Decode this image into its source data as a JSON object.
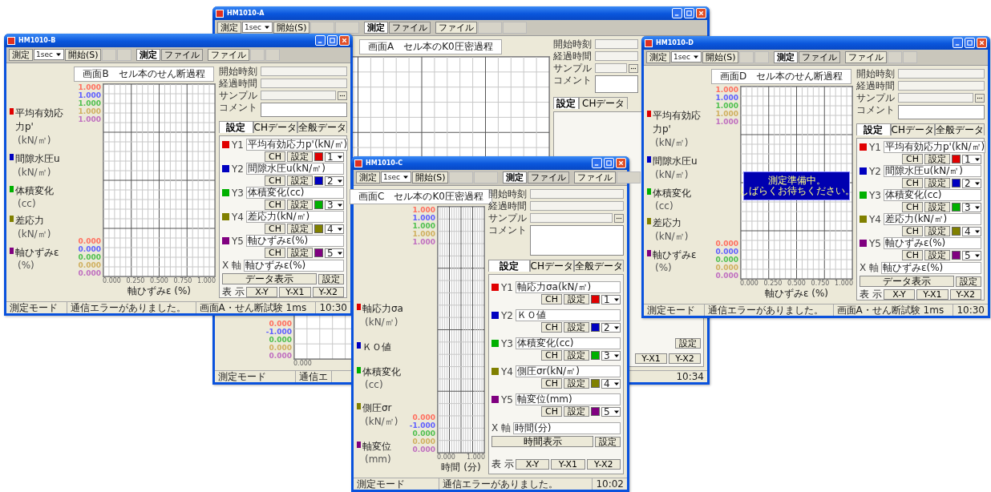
{
  "windows": [
    {
      "title": "HM1010-A",
      "toolbar": [
        [
          {
            "kind": "button",
            "label": "測定"
          },
          {
            "kind": "select",
            "label": "1sec"
          },
          {
            "kind": "button",
            "label": "開始(S)"
          },
          {
            "kind": "disabled"
          },
          {
            "kind": "disabled"
          }
        ],
        [
          {
            "kind": "toggle",
            "label": "測定",
            "selected": true
          },
          {
            "kind": "toggle",
            "label": "ファイル",
            "selected": false
          }
        ],
        [
          {
            "kind": "button",
            "label": "ファイル"
          },
          {
            "kind": "disabled"
          },
          {
            "kind": "disabled"
          }
        ]
      ],
      "chart": {
        "title": "画面A　セル本のK0圧密過程",
        "ticks_bottom": [
          {
            "text": "0.000",
            "color": "#ff7060"
          },
          {
            "text": "-1.000",
            "color": "#6060ff"
          },
          {
            "text": "0.000",
            "color": "#50c050"
          },
          {
            "text": "0.000",
            "color": "#d0b060"
          },
          {
            "text": "0.000",
            "color": "#c070c0"
          }
        ],
        "x_ticks": [
          "0.000"
        ]
      },
      "info": [
        {
          "label": "開始時刻",
          "kind": "field"
        },
        {
          "label": "経過時間",
          "kind": "field"
        },
        {
          "label": "サンプル",
          "kind": "browse"
        },
        {
          "label": "コメント",
          "kind": "comment"
        }
      ],
      "tabs": [
        {
          "label": "設定",
          "selected": true
        },
        {
          "label": "CHデータ",
          "selected": false
        }
      ],
      "x_axis": {
        "buttons": [
          "設定"
        ]
      },
      "display": {
        "buttons": [
          "Y-X1",
          "Y-X2"
        ]
      },
      "status": [
        "測定モード",
        "通信エ",
        "10:34"
      ]
    },
    {
      "title": "HM1010-B",
      "toolbar": [
        [
          {
            "kind": "button",
            "label": "測定"
          },
          {
            "kind": "select",
            "label": "1sec"
          },
          {
            "kind": "button",
            "label": "開始(S)"
          },
          {
            "kind": "disabled"
          },
          {
            "kind": "disabled"
          }
        ],
        [
          {
            "kind": "toggle",
            "label": "測定",
            "selected": true
          },
          {
            "kind": "toggle",
            "label": "ファイル",
            "selected": false
          }
        ],
        [
          {
            "kind": "button",
            "label": "ファイル"
          },
          {
            "kind": "disabled"
          },
          {
            "kind": "disabled"
          }
        ]
      ],
      "chart": {
        "title": "画面B　セル本のせん断過程",
        "ticks_top": [
          {
            "text": "1.000",
            "color": "#ff7060"
          },
          {
            "text": "1.000",
            "color": "#6060ff"
          },
          {
            "text": "1.000",
            "color": "#50c050"
          },
          {
            "text": "1.000",
            "color": "#d0b060"
          },
          {
            "text": "1.000",
            "color": "#c070c0"
          }
        ],
        "ticks_bottom": [
          {
            "text": "0.000",
            "color": "#ff7060"
          },
          {
            "text": "0.000",
            "color": "#6060ff"
          },
          {
            "text": "0.000",
            "color": "#50c050"
          },
          {
            "text": "0.000",
            "color": "#d0b060"
          },
          {
            "text": "0.000",
            "color": "#c070c0"
          }
        ],
        "x_ticks": [
          "0.000",
          "0.250",
          "0.500",
          "0.750",
          "1.000"
        ],
        "x_label": "軸ひずみε (%)"
      },
      "legend": [
        {
          "label": "平均有効応力p'",
          "unit": "(kN/㎡)",
          "color": "#e00000"
        },
        {
          "label": "間隙水圧u",
          "unit": "(kN/㎡)",
          "color": "#0000c0"
        },
        {
          "label": "体積変化",
          "unit": "(cc)",
          "color": "#00b000"
        },
        {
          "label": "差応力",
          "unit": "(kN/㎡)",
          "color": "#808000"
        },
        {
          "label": "軸ひずみε",
          "unit": "(%)",
          "color": "#800080"
        }
      ],
      "info": [
        {
          "label": "開始時刻",
          "kind": "field"
        },
        {
          "label": "経過時間",
          "kind": "field"
        },
        {
          "label": "サンプル",
          "kind": "browse"
        },
        {
          "label": "コメント",
          "kind": "comment"
        }
      ],
      "tabs": [
        {
          "label": "設定",
          "selected": true
        },
        {
          "label": "CHデータ",
          "selected": false
        },
        {
          "label": "全般データ",
          "selected": false
        }
      ],
      "channels": [
        {
          "axis": "Y1",
          "name": "平均有効応力p'(kN/㎡)",
          "color": "#e00000",
          "buttons": [
            "CH",
            "設定"
          ],
          "number": "1"
        },
        {
          "axis": "Y2",
          "name": "間隙水圧u(kN/㎡)",
          "color": "#0000c0",
          "buttons": [
            "CH",
            "設定"
          ],
          "number": "2"
        },
        {
          "axis": "Y3",
          "name": "体積変化(cc)",
          "color": "#00b000",
          "buttons": [
            "CH",
            "設定"
          ],
          "number": "3"
        },
        {
          "axis": "Y4",
          "name": "差応力(kN/㎡)",
          "color": "#808000",
          "buttons": [
            "CH",
            "設定"
          ],
          "number": "4"
        },
        {
          "axis": "Y5",
          "name": "軸ひずみε(%)",
          "color": "#800080",
          "buttons": [
            "CH",
            "設定"
          ],
          "number": "5"
        }
      ],
      "x_axis": {
        "axis": "X 軸",
        "name": "軸ひずみε(%)",
        "buttons": [
          "データ表示",
          "設定"
        ]
      },
      "display": {
        "label": "表 示",
        "buttons": [
          "X-Y",
          "Y-X1",
          "Y-X2"
        ]
      },
      "status": [
        "測定モード",
        "通信エラーがありました。",
        "画面A・せん断試験 1ms",
        "10:30"
      ]
    },
    {
      "title": "HM1010-D",
      "toolbar": [
        [
          {
            "kind": "button",
            "label": "測定"
          },
          {
            "kind": "select",
            "label": "1sec"
          },
          {
            "kind": "button",
            "label": "開始(S)"
          },
          {
            "kind": "disabled"
          },
          {
            "kind": "disabled"
          }
        ],
        [
          {
            "kind": "toggle",
            "label": "測定",
            "selected": true
          },
          {
            "kind": "toggle",
            "label": "ファイル",
            "selected": false
          }
        ],
        [
          {
            "kind": "button",
            "label": "ファイル"
          },
          {
            "kind": "disabled"
          },
          {
            "kind": "disabled"
          }
        ]
      ],
      "chart": {
        "title": "画面D　セル本のせん断過程",
        "ticks_top": [
          {
            "text": "1.000",
            "color": "#ff7060"
          },
          {
            "text": "1.000",
            "color": "#6060ff"
          },
          {
            "text": "1.000",
            "color": "#50c050"
          },
          {
            "text": "1.000",
            "color": "#d0b060"
          },
          {
            "text": "1.000",
            "color": "#c070c0"
          }
        ],
        "ticks_bottom": [
          {
            "text": "0.000",
            "color": "#ff7060"
          },
          {
            "text": "0.000",
            "color": "#6060ff"
          },
          {
            "text": "0.000",
            "color": "#50c050"
          },
          {
            "text": "0.000",
            "color": "#d0b060"
          },
          {
            "text": "0.000",
            "color": "#c070c0"
          }
        ],
        "x_ticks": [
          "0.000",
          "0.250",
          "0.500",
          "0.750",
          "1.000"
        ],
        "x_label": "軸ひずみε (%)",
        "banner": [
          "測定準備中。",
          "しばらくお待ちください。"
        ]
      },
      "legend": [
        {
          "label": "平均有効応力p'",
          "unit": "(kN/㎡)",
          "color": "#e00000"
        },
        {
          "label": "間隙水圧u",
          "unit": "(kN/㎡)",
          "color": "#0000c0"
        },
        {
          "label": "体積変化",
          "unit": "(cc)",
          "color": "#00b000"
        },
        {
          "label": "差応力",
          "unit": "(kN/㎡)",
          "color": "#808000"
        },
        {
          "label": "軸ひずみε",
          "unit": "(%)",
          "color": "#800080"
        }
      ],
      "info": [
        {
          "label": "開始時刻",
          "kind": "field"
        },
        {
          "label": "経過時間",
          "kind": "field"
        },
        {
          "label": "サンプル",
          "kind": "browse"
        },
        {
          "label": "コメント",
          "kind": "comment"
        }
      ],
      "tabs": [
        {
          "label": "設定",
          "selected": true
        },
        {
          "label": "CHデータ",
          "selected": false
        },
        {
          "label": "全般データ",
          "selected": false
        }
      ],
      "channels": [
        {
          "axis": "Y1",
          "name": "平均有効応力p'(kN/㎡)",
          "color": "#e00000",
          "buttons": [
            "CH",
            "設定"
          ],
          "number": "1"
        },
        {
          "axis": "Y2",
          "name": "間隙水圧u(kN/㎡)",
          "color": "#0000c0",
          "buttons": [
            "CH",
            "設定"
          ],
          "number": "2"
        },
        {
          "axis": "Y3",
          "name": "体積変化(cc)",
          "color": "#00b000",
          "buttons": [
            "CH",
            "設定"
          ],
          "number": "3"
        },
        {
          "axis": "Y4",
          "name": "差応力(kN/㎡)",
          "color": "#808000",
          "buttons": [
            "CH",
            "設定"
          ],
          "number": "4"
        },
        {
          "axis": "Y5",
          "name": "軸ひずみε(%)",
          "color": "#800080",
          "buttons": [
            "CH",
            "設定"
          ],
          "number": "5"
        }
      ],
      "x_axis": {
        "axis": "X 軸",
        "name": "軸ひずみε(%)",
        "buttons": [
          "データ表示",
          "設定"
        ]
      },
      "display": {
        "label": "表 示",
        "buttons": [
          "X-Y",
          "Y-X1",
          "Y-X2"
        ]
      },
      "status": [
        "測定モード",
        "通信エラーがありました。",
        "画面A・せん断試験 1ms",
        "10:30"
      ]
    },
    {
      "title": "HM1010-C",
      "toolbar": [
        [
          {
            "kind": "button",
            "label": "測定"
          },
          {
            "kind": "select",
            "label": "1sec"
          },
          {
            "kind": "button",
            "label": "開始(S)"
          },
          {
            "kind": "disabled"
          },
          {
            "kind": "disabled"
          }
        ],
        [
          {
            "kind": "toggle",
            "label": "測定",
            "selected": true
          },
          {
            "kind": "toggle",
            "label": "ファイル",
            "selected": false
          }
        ],
        [
          {
            "kind": "button",
            "label": "ファイル"
          },
          {
            "kind": "disabled"
          }
        ]
      ],
      "chart": {
        "title": "画面C　セル本のK0圧密過程",
        "ticks_top": [
          {
            "text": "1.000",
            "color": "#ff7060"
          },
          {
            "text": "1.000",
            "color": "#6060ff"
          },
          {
            "text": "1.000",
            "color": "#50c050"
          },
          {
            "text": "1.000",
            "color": "#d0b060"
          },
          {
            "text": "1.000",
            "color": "#c070c0"
          }
        ],
        "ticks_bottom": [
          {
            "text": "0.000",
            "color": "#ff7060"
          },
          {
            "text": "-1.000",
            "color": "#6060ff"
          },
          {
            "text": "0.000",
            "color": "#50c050"
          },
          {
            "text": "0.000",
            "color": "#d0b060"
          },
          {
            "text": "0.000",
            "color": "#c070c0"
          }
        ],
        "x_ticks": [
          "0.000",
          "1.000"
        ],
        "x_label": "時間 (分)"
      },
      "legend": [
        {
          "label": "軸応力σa",
          "unit": "(kN/㎡)",
          "color": "#e00000"
        },
        {
          "label": "ＫＯ値",
          "color": "#0000c0"
        },
        {
          "label": "体積変化",
          "unit": "(cc)",
          "color": "#00b000"
        },
        {
          "label": "側圧σr",
          "unit": "(kN/㎡)",
          "color": "#808000"
        },
        {
          "label": "軸変位",
          "unit": "(mm)",
          "color": "#800080"
        }
      ],
      "info": [
        {
          "label": "開始時刻",
          "kind": "field"
        },
        {
          "label": "経過時間",
          "kind": "field"
        },
        {
          "label": "サンプル",
          "kind": "browse"
        },
        {
          "label": "コメント",
          "kind": "comment"
        }
      ],
      "tabs": [
        {
          "label": "設定",
          "selected": true
        },
        {
          "label": "CHデータ",
          "selected": false
        },
        {
          "label": "全般データ",
          "selected": false
        }
      ],
      "channels": [
        {
          "axis": "Y1",
          "name": "軸応力σa(kN/㎡)",
          "color": "#e00000",
          "buttons": [
            "CH",
            "設定"
          ],
          "number": "1"
        },
        {
          "axis": "Y2",
          "name": "ＫＯ値",
          "color": "#0000c0",
          "buttons": [
            "CH",
            "設定"
          ],
          "number": "2"
        },
        {
          "axis": "Y3",
          "name": "体積変化(cc)",
          "color": "#00b000",
          "buttons": [
            "CH",
            "設定"
          ],
          "number": "3"
        },
        {
          "axis": "Y4",
          "name": "側圧σr(kN/㎡)",
          "color": "#808000",
          "buttons": [
            "CH",
            "設定"
          ],
          "number": "4"
        },
        {
          "axis": "Y5",
          "name": "軸変位(mm)",
          "color": "#800080",
          "buttons": [
            "CH",
            "設定"
          ],
          "number": "5"
        }
      ],
      "x_axis": {
        "axis": "X 軸",
        "name": "時間(分)",
        "buttons": [
          "時間表示",
          "設定"
        ]
      },
      "display": {
        "label": "表 示",
        "buttons": [
          "X-Y",
          "Y-X1",
          "Y-X2"
        ]
      },
      "status": [
        "測定モード",
        "通信エラーがありました。",
        "10:02"
      ]
    }
  ]
}
